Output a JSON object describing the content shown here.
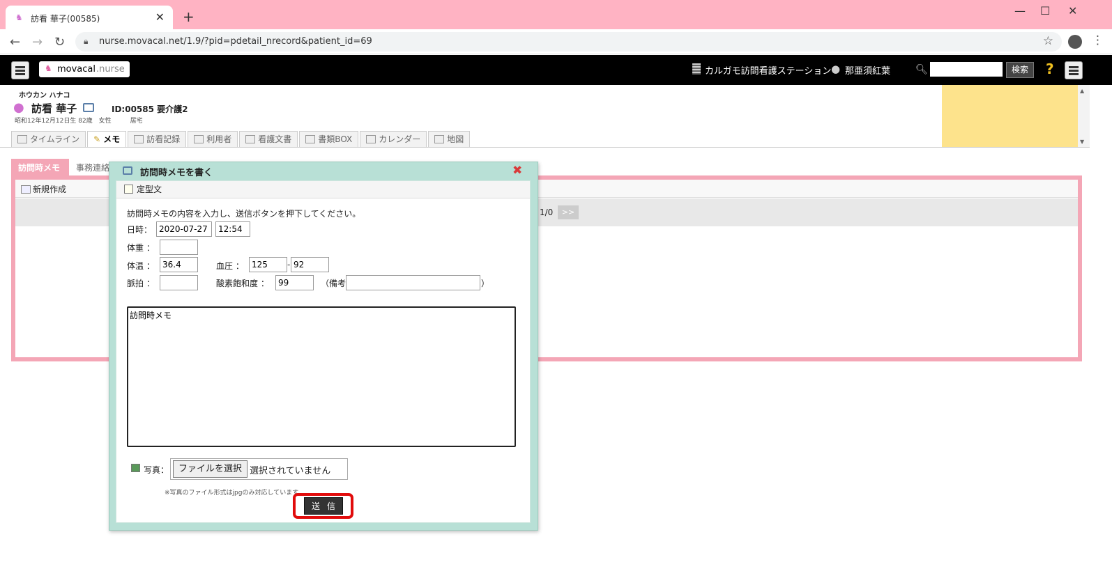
{
  "browser": {
    "tab_title": "訪看 華子(00585)",
    "tab_close": "✕",
    "new_tab": "+",
    "url": "nurse.movacal.net/1.9/?pid=pdetail_nrecord&patient_id=69",
    "win_min": "—",
    "win_max": "☐",
    "win_close": "✕"
  },
  "header": {
    "logo_main": "movacal",
    "logo_sub": ".nurse",
    "station": "カルガモ訪問看護ステーション",
    "user": "那亜須紅葉",
    "search_button": "検索",
    "help": "?"
  },
  "patient": {
    "kana": "ホウカン ハナコ",
    "name": "訪看 華子",
    "id_care": "ID:00585 要介護2",
    "info": "昭和12年12月12日生 82歳　女性　　　居宅"
  },
  "nav_tabs": [
    {
      "label": "タイムライン",
      "active": false
    },
    {
      "label": "メモ",
      "active": true
    },
    {
      "label": "訪看記録",
      "active": false
    },
    {
      "label": "利用者",
      "active": false
    },
    {
      "label": "看護文書",
      "active": false
    },
    {
      "label": "書類BOX",
      "active": false
    },
    {
      "label": "カレンダー",
      "active": false
    },
    {
      "label": "地図",
      "active": false
    }
  ],
  "memo_page": {
    "subtab_active": "訪問時メモ",
    "subtab_other": "事務連絡",
    "new_button": "新規作成",
    "pager": "1/0",
    "next": ">>"
  },
  "modal": {
    "title": "訪問時メモを書く",
    "close": "✖",
    "template": "定型文",
    "instruction": "訪問時メモの内容を入力し、送信ボタンを押下してください。",
    "date_label": "日時：",
    "date_value": "2020-07-27",
    "time_value": "12:54",
    "weight_label": "体重 ：",
    "weight_value": "",
    "temp_label": "体温 ：",
    "temp_value": "36.4",
    "bp_label": "血圧 ：",
    "bp_high": "125",
    "bp_sep": "-",
    "bp_low": "92",
    "pulse_label": "脈拍 ：",
    "pulse_value": "",
    "spo2_label": "酸素飽和度 ：",
    "spo2_value": "99",
    "remarks_open": "（備考",
    "remarks_value": "",
    "remarks_close": "）",
    "memo_text": "訪問時メモ",
    "photo_label": "写真：",
    "file_button": "ファイルを選択",
    "file_status": "選択されていません",
    "note": "※写真のファイル形式はjpgのみ対応しています",
    "send": "送信"
  }
}
